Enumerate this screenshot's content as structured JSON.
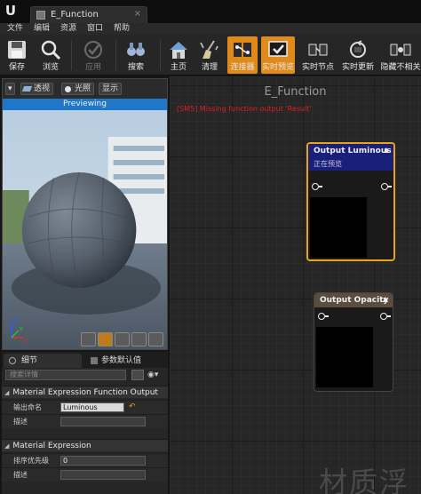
{
  "tab": {
    "title": "E_Function",
    "close": "×"
  },
  "menu": [
    "文件",
    "编辑",
    "资源",
    "窗口",
    "帮助"
  ],
  "toolbar": {
    "save": "保存",
    "browse": "浏览",
    "apply": "应用",
    "search": "搜索",
    "home": "主页",
    "clean": "清理",
    "connectors": "连接器",
    "live_preview": "实时预览",
    "live_nodes": "实时节点",
    "live_update": "实时更新",
    "hide_unrelated": "隐藏不相关"
  },
  "viewport": {
    "dropdown": "▾",
    "perspective": "透视",
    "lit": "光照",
    "show": "显示",
    "previewing": "Previewing",
    "axis_z": "Z",
    "axis_y": "Y",
    "axis_x": "X"
  },
  "details": {
    "tab_details": "细节",
    "tab_params": "参数默认值",
    "search_placeholder": "搜索详情",
    "section1": "Material Expression Function Output",
    "output_name_label": "输出命名",
    "output_name_value": "Luminous",
    "desc_label": "描述",
    "section2": "Material Expression",
    "sort_label": "排序优先级",
    "sort_value": "0",
    "desc2_label": "描述"
  },
  "graph": {
    "title": "E_Function",
    "error": "[SM5] Missing function output 'Result'",
    "watermark": "材质浮",
    "node_luminous": {
      "title": "Output Luminous",
      "status": "正在预览"
    },
    "node_opacity": {
      "title": "Output Opacity"
    }
  },
  "colors": {
    "accent": "#e08a1a",
    "previewing_bar": "#1f77c9",
    "node_luminous_header": "#1a1f7a",
    "node_opacity_header": "#5a4d3f",
    "error_text": "#e02020"
  }
}
